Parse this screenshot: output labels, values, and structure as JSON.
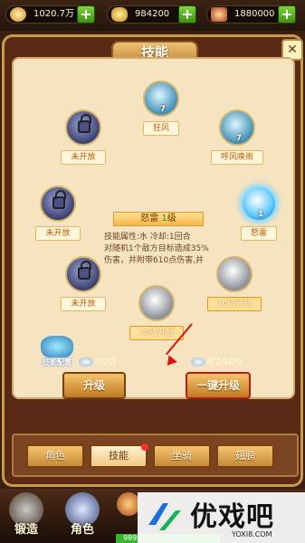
{
  "resources": [
    {
      "icon": "wing-gem-icon",
      "value": "1020.7万"
    },
    {
      "icon": "gold-ingot-icon",
      "value": "984200"
    },
    {
      "icon": "treasure-icon",
      "value": "1880000"
    }
  ],
  "panel": {
    "title": "技能"
  },
  "skills": [
    {
      "name": "狂风",
      "level": "7",
      "state": "wind"
    },
    {
      "name": "呼风唤雨",
      "level": "7",
      "state": "wind"
    },
    {
      "name": "未开放",
      "level": "",
      "state": "locked"
    },
    {
      "name": "未开放",
      "level": "",
      "state": "locked"
    },
    {
      "name": "怒雷",
      "level": "1",
      "state": "storm"
    },
    {
      "name": "未开放",
      "level": "",
      "state": "locked"
    },
    {
      "name": "10级开放",
      "level": "",
      "state": "silver"
    },
    {
      "name": "30级开放",
      "level": "",
      "state": "silver"
    }
  ],
  "detail": {
    "name": "怒雷",
    "level_num": "1",
    "level_unit": "级",
    "line1": "技能属性:水    冷却:1回合",
    "line2": "对随机1个敌方目标造成35%",
    "line3": "伤害，并附带610点伤害,并"
  },
  "badge": {
    "label": "技能配置"
  },
  "costs": {
    "single": "500",
    "all": "82400"
  },
  "buttons": {
    "upgrade": "升级",
    "upgrade_all": "一键升级"
  },
  "tabs": [
    "角色",
    "技能",
    "坐骑",
    "翅膀"
  ],
  "bottom_nav": [
    {
      "label": "锻造",
      "icon": "anvil-icon"
    },
    {
      "label": "角色",
      "icon": "character-icon"
    },
    {
      "label": "",
      "icon": "menu-icon"
    }
  ],
  "exp_text": "9891",
  "exp_fraction": 0.55,
  "watermark": {
    "text": "优戏吧",
    "url": "YOXI8.COM"
  },
  "colors": {
    "panel_bg": "#f6e4c1",
    "accent_orange": "#f5b84a",
    "arrow_red": "#e01010",
    "plus_green": "#5cb52a"
  }
}
